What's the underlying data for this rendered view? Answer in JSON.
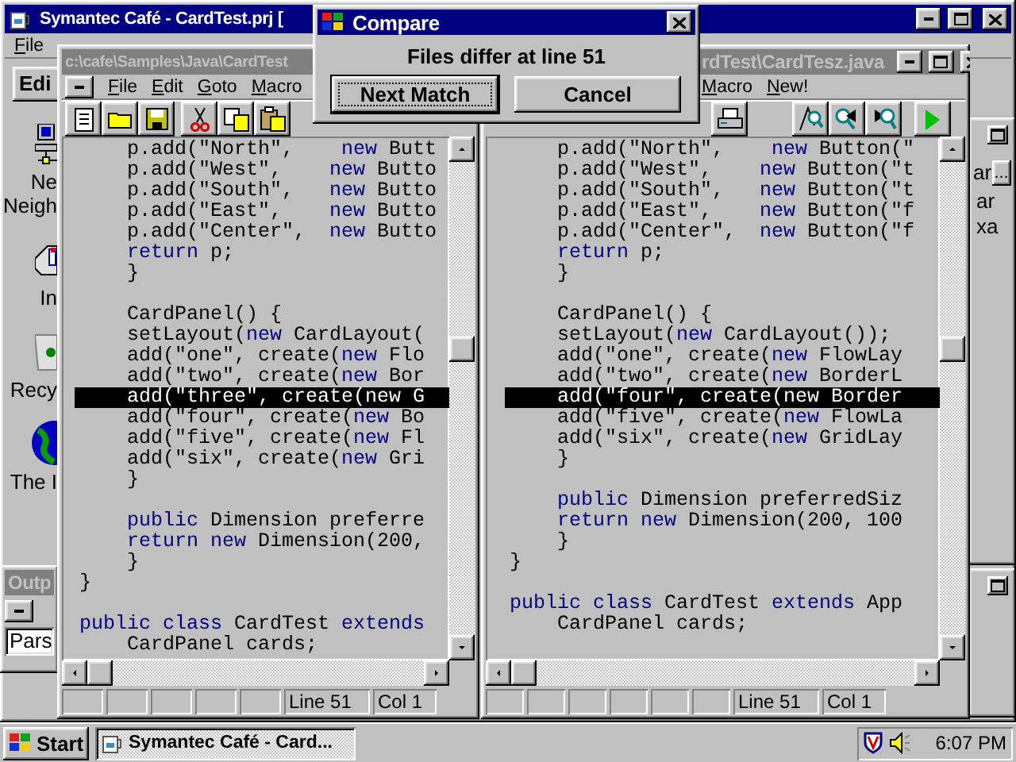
{
  "main_window": {
    "title": "Symantec Café - CardTest.prj [",
    "menu": [
      "File"
    ],
    "tab": "Edi"
  },
  "desktop_icons": [
    {
      "kind": "network",
      "label": "Ne\nNeigh"
    },
    {
      "kind": "inbox",
      "label": "In"
    },
    {
      "kind": "recycle",
      "label": "Recy"
    },
    {
      "kind": "globe",
      "label": "The I"
    }
  ],
  "left_editor": {
    "title": "c:\\cafe\\Samples\\Java\\CardTest",
    "menu": [
      "File",
      "Edit",
      "Goto",
      "Macro"
    ],
    "status": [
      "Line 51",
      "Col 1"
    ],
    "lines": [
      {
        "kind": "code",
        "highlighted": false,
        "segments": [
          {
            "t": "    p.add(\"North\",    ",
            "kw": false
          },
          {
            "t": "new",
            "kw": true
          },
          {
            "t": " Butt",
            "kw": false
          }
        ]
      },
      {
        "kind": "code",
        "highlighted": false,
        "segments": [
          {
            "t": "    p.add(\"West\",    ",
            "kw": false
          },
          {
            "t": "new",
            "kw": true
          },
          {
            "t": " Butto",
            "kw": false
          }
        ]
      },
      {
        "kind": "code",
        "highlighted": false,
        "segments": [
          {
            "t": "    p.add(\"South\",   ",
            "kw": false
          },
          {
            "t": "new",
            "kw": true
          },
          {
            "t": " Butto",
            "kw": false
          }
        ]
      },
      {
        "kind": "code",
        "highlighted": false,
        "segments": [
          {
            "t": "    p.add(\"East\",    ",
            "kw": false
          },
          {
            "t": "new",
            "kw": true
          },
          {
            "t": " Butto",
            "kw": false
          }
        ]
      },
      {
        "kind": "code",
        "highlighted": false,
        "segments": [
          {
            "t": "    p.add(\"Center\",  ",
            "kw": false
          },
          {
            "t": "new",
            "kw": true
          },
          {
            "t": " Butto",
            "kw": false
          }
        ]
      },
      {
        "kind": "code",
        "highlighted": false,
        "segments": [
          {
            "t": "    return",
            "kw": true
          },
          {
            "t": " p;",
            "kw": false
          }
        ]
      },
      {
        "kind": "code",
        "highlighted": false,
        "segments": [
          {
            "t": "    }",
            "kw": false
          }
        ]
      },
      {
        "kind": "blank",
        "highlighted": false
      },
      {
        "kind": "code",
        "highlighted": false,
        "segments": [
          {
            "t": "    CardPanel() {",
            "kw": false
          }
        ]
      },
      {
        "kind": "code",
        "highlighted": false,
        "segments": [
          {
            "t": "    setLayout(",
            "kw": false
          },
          {
            "t": "new",
            "kw": true
          },
          {
            "t": " CardLayout(",
            "kw": false
          }
        ]
      },
      {
        "kind": "code",
        "highlighted": false,
        "segments": [
          {
            "t": "    add(\"one\", create(",
            "kw": false
          },
          {
            "t": "new",
            "kw": true
          },
          {
            "t": " Flo",
            "kw": false
          }
        ]
      },
      {
        "kind": "code",
        "highlighted": false,
        "segments": [
          {
            "t": "    add(\"two\", create(",
            "kw": false
          },
          {
            "t": "new",
            "kw": true
          },
          {
            "t": " Bor",
            "kw": false
          }
        ]
      },
      {
        "kind": "code",
        "highlighted": true,
        "text": "    add(\"three\", create(new G"
      },
      {
        "kind": "code",
        "highlighted": false,
        "segments": [
          {
            "t": "    add(\"four\", create(",
            "kw": false
          },
          {
            "t": "new",
            "kw": true
          },
          {
            "t": " Bo",
            "kw": false
          }
        ]
      },
      {
        "kind": "code",
        "highlighted": false,
        "segments": [
          {
            "t": "    add(\"five\", create(",
            "kw": false
          },
          {
            "t": "new",
            "kw": true
          },
          {
            "t": " Fl",
            "kw": false
          }
        ]
      },
      {
        "kind": "code",
        "highlighted": false,
        "segments": [
          {
            "t": "    add(\"six\", create(",
            "kw": false
          },
          {
            "t": "new",
            "kw": true
          },
          {
            "t": " Gri",
            "kw": false
          }
        ]
      },
      {
        "kind": "code",
        "highlighted": false,
        "segments": [
          {
            "t": "    }",
            "kw": false
          }
        ]
      },
      {
        "kind": "blank",
        "highlighted": false
      },
      {
        "kind": "code",
        "highlighted": false,
        "segments": [
          {
            "t": "    public",
            "kw": true
          },
          {
            "t": " Dimension preferre",
            "kw": false
          }
        ]
      },
      {
        "kind": "code",
        "highlighted": false,
        "segments": [
          {
            "t": "    return new",
            "kw": true
          },
          {
            "t": " Dimension(200,",
            "kw": false
          }
        ]
      },
      {
        "kind": "code",
        "highlighted": false,
        "segments": [
          {
            "t": "    }",
            "kw": false
          }
        ]
      },
      {
        "kind": "code",
        "highlighted": false,
        "segments": [
          {
            "t": "}",
            "kw": false
          }
        ]
      },
      {
        "kind": "blank",
        "highlighted": false
      },
      {
        "kind": "code",
        "highlighted": false,
        "segments": [
          {
            "t": "public class",
            "kw": true
          },
          {
            "t": " CardTest ",
            "kw": false
          },
          {
            "t": "extends",
            "kw": true
          }
        ]
      },
      {
        "kind": "code",
        "highlighted": false,
        "segments": [
          {
            "t": "    CardPanel cards;",
            "kw": false
          }
        ]
      }
    ]
  },
  "right_editor": {
    "title": "rdTest\\CardTesz.java",
    "menu": [
      "Macro",
      "New!"
    ],
    "status": [
      "Line 51",
      "Col 1"
    ],
    "lines": [
      {
        "kind": "code",
        "highlighted": false,
        "segments": [
          {
            "t": "    p.add(\"North\",    ",
            "kw": false
          },
          {
            "t": "new",
            "kw": true
          },
          {
            "t": " Button(\"",
            "kw": false
          }
        ]
      },
      {
        "kind": "code",
        "highlighted": false,
        "segments": [
          {
            "t": "    p.add(\"West\",    ",
            "kw": false
          },
          {
            "t": "new",
            "kw": true
          },
          {
            "t": " Button(\"t",
            "kw": false
          }
        ]
      },
      {
        "kind": "code",
        "highlighted": false,
        "segments": [
          {
            "t": "    p.add(\"South\",   ",
            "kw": false
          },
          {
            "t": "new",
            "kw": true
          },
          {
            "t": " Button(\"t",
            "kw": false
          }
        ]
      },
      {
        "kind": "code",
        "highlighted": false,
        "segments": [
          {
            "t": "    p.add(\"East\",    ",
            "kw": false
          },
          {
            "t": "new",
            "kw": true
          },
          {
            "t": " Button(\"f",
            "kw": false
          }
        ]
      },
      {
        "kind": "code",
        "highlighted": false,
        "segments": [
          {
            "t": "    p.add(\"Center\",  ",
            "kw": false
          },
          {
            "t": "new",
            "kw": true
          },
          {
            "t": " Button(\"f",
            "kw": false
          }
        ]
      },
      {
        "kind": "code",
        "highlighted": false,
        "segments": [
          {
            "t": "    return",
            "kw": true
          },
          {
            "t": " p;",
            "kw": false
          }
        ]
      },
      {
        "kind": "code",
        "highlighted": false,
        "segments": [
          {
            "t": "    }",
            "kw": false
          }
        ]
      },
      {
        "kind": "blank",
        "highlighted": false
      },
      {
        "kind": "code",
        "highlighted": false,
        "segments": [
          {
            "t": "    CardPanel() {",
            "kw": false
          }
        ]
      },
      {
        "kind": "code",
        "highlighted": false,
        "segments": [
          {
            "t": "    setLayout(",
            "kw": false
          },
          {
            "t": "new",
            "kw": true
          },
          {
            "t": " CardLayout());",
            "kw": false
          }
        ]
      },
      {
        "kind": "code",
        "highlighted": false,
        "segments": [
          {
            "t": "    add(\"one\", create(",
            "kw": false
          },
          {
            "t": "new",
            "kw": true
          },
          {
            "t": " FlowLay",
            "kw": false
          }
        ]
      },
      {
        "kind": "code",
        "highlighted": false,
        "segments": [
          {
            "t": "    add(\"two\", create(",
            "kw": false
          },
          {
            "t": "new",
            "kw": true
          },
          {
            "t": " BorderL",
            "kw": false
          }
        ]
      },
      {
        "kind": "code",
        "highlighted": true,
        "text": "    add(\"four\", create(new Border"
      },
      {
        "kind": "code",
        "highlighted": false,
        "segments": [
          {
            "t": "    add(\"five\", create(",
            "kw": false
          },
          {
            "t": "new",
            "kw": true
          },
          {
            "t": " FlowLa",
            "kw": false
          }
        ]
      },
      {
        "kind": "code",
        "highlighted": false,
        "segments": [
          {
            "t": "    add(\"six\", create(",
            "kw": false
          },
          {
            "t": "new",
            "kw": true
          },
          {
            "t": " GridLay",
            "kw": false
          }
        ]
      },
      {
        "kind": "code",
        "highlighted": false,
        "segments": [
          {
            "t": "    }",
            "kw": false
          }
        ]
      },
      {
        "kind": "blank",
        "highlighted": false
      },
      {
        "kind": "code",
        "highlighted": false,
        "segments": [
          {
            "t": "    public",
            "kw": true
          },
          {
            "t": " Dimension preferredSiz",
            "kw": false
          }
        ]
      },
      {
        "kind": "code",
        "highlighted": false,
        "segments": [
          {
            "t": "    return new",
            "kw": true
          },
          {
            "t": " Dimension(200, 100",
            "kw": false
          }
        ]
      },
      {
        "kind": "code",
        "highlighted": false,
        "segments": [
          {
            "t": "    }",
            "kw": false
          }
        ]
      },
      {
        "kind": "code",
        "highlighted": false,
        "segments": [
          {
            "t": "}",
            "kw": false
          }
        ]
      },
      {
        "kind": "blank",
        "highlighted": false
      },
      {
        "kind": "code",
        "highlighted": false,
        "segments": [
          {
            "t": "public class",
            "kw": true
          },
          {
            "t": " CardTest ",
            "kw": false
          },
          {
            "t": "extends",
            "kw": true
          },
          {
            "t": " App",
            "kw": false
          }
        ]
      },
      {
        "kind": "code",
        "highlighted": false,
        "segments": [
          {
            "t": "    CardPanel cards;",
            "kw": false
          }
        ]
      }
    ]
  },
  "side_panel": {
    "button": "...",
    "items": [
      "ar",
      "ar",
      "xa"
    ]
  },
  "output_window": {
    "title": "Outp",
    "field": "Pars"
  },
  "dialog": {
    "title": "Compare",
    "message": "Files differ at line 51",
    "buttons": [
      {
        "label": "Next Match",
        "default": true
      },
      {
        "label": "Cancel",
        "default": false
      }
    ]
  },
  "taskbar": {
    "start": "Start",
    "tasks": [
      {
        "label": "Symantec Café - Card...",
        "selected": true
      }
    ],
    "clock": "6:07 PM"
  }
}
